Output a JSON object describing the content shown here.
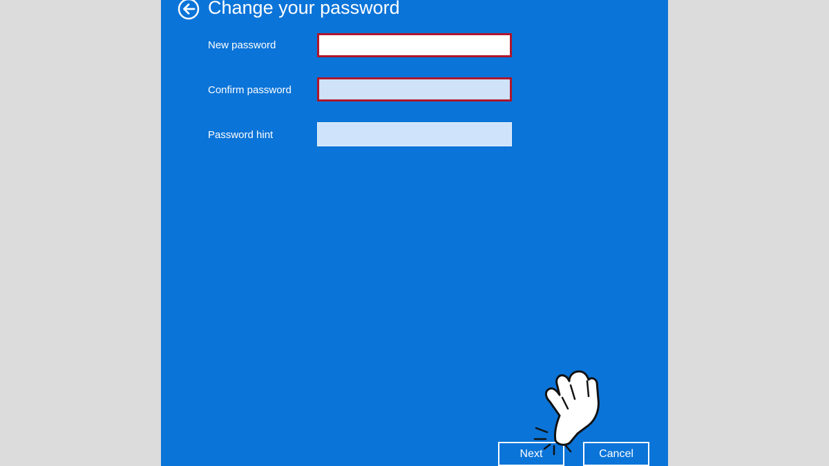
{
  "window": {
    "title": "Change your password",
    "accent_color": "#0b74d8",
    "error_color": "#b0162a"
  },
  "back": {
    "icon": "back-arrow-icon"
  },
  "form": {
    "new_password": {
      "label": "New password",
      "value": "",
      "state": "error"
    },
    "confirm_password": {
      "label": "Confirm password",
      "value": "",
      "state": "error"
    },
    "password_hint": {
      "label": "Password hint",
      "value": ""
    }
  },
  "buttons": {
    "next_label": "Next",
    "cancel_label": "Cancel"
  },
  "overlay": {
    "icon": "pointing-hand-icon"
  }
}
